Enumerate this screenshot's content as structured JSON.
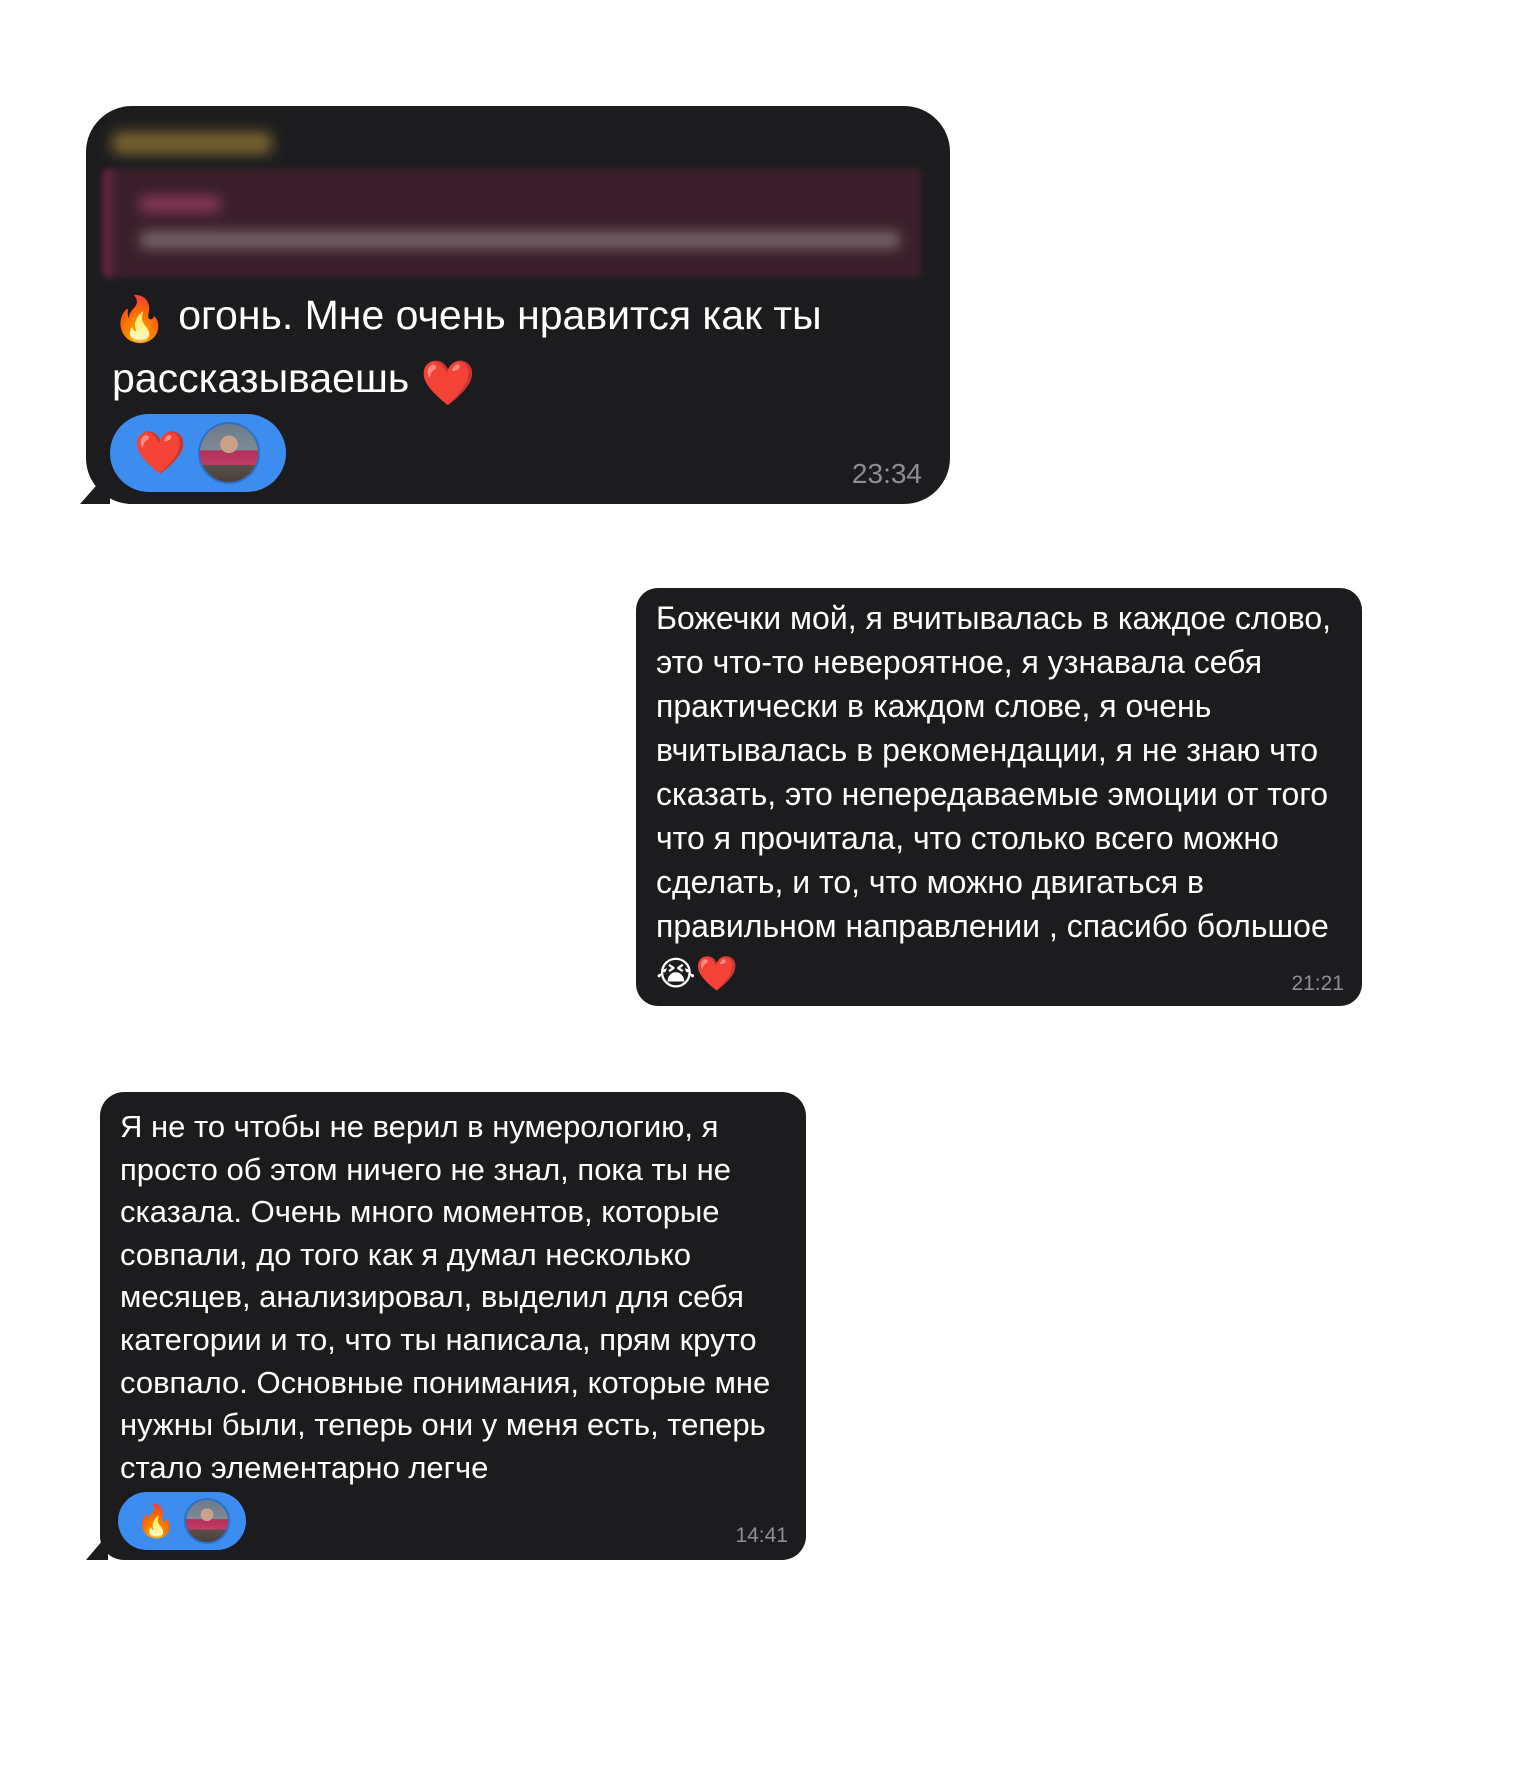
{
  "messages": [
    {
      "side": "incoming",
      "has_reply_quote": true,
      "text": "огонь. Мне очень нравится как ты рассказываешь",
      "lead_emoji": "🔥",
      "trail_emoji": "❤️",
      "reaction": {
        "emoji": "❤️",
        "reactor": "avatar"
      },
      "time": "23:34"
    },
    {
      "side": "outgoing",
      "text": "Божечки мой, я вчитывалась в каждое слово, это что-то невероятное, я узнавала себя практически в каждом слове, я очень вчитывалась в рекомендации, я не знаю что сказать, это непередаваемые эмоции от того что я прочитала, что столько всего можно сделать, и то, что можно двигаться в правильном направлении , спасибо большое",
      "trail_emoji": "😭❤️",
      "time": "21:21"
    },
    {
      "side": "incoming",
      "text": "Я не то чтобы не верил в нумерологию, я просто об этом ничего не знал, пока ты не сказала. Очень много моментов, которые совпали, до того как я думал несколько месяцев, анализировал, выделил для себя категории и то, что ты написала, прям круто совпало. Основные понимания, которые мне нужны были, теперь они у меня есть, теперь стало элементарно легче",
      "reaction": {
        "emoji": "🔥",
        "reactor": "avatar"
      },
      "time": "14:41"
    }
  ],
  "colors": {
    "bubble_bg": "#1c1c1e",
    "text": "#ffffff",
    "time": "#8e8e93",
    "reaction_pill": "#3d8cf0",
    "page_bg": "#ffffff"
  }
}
